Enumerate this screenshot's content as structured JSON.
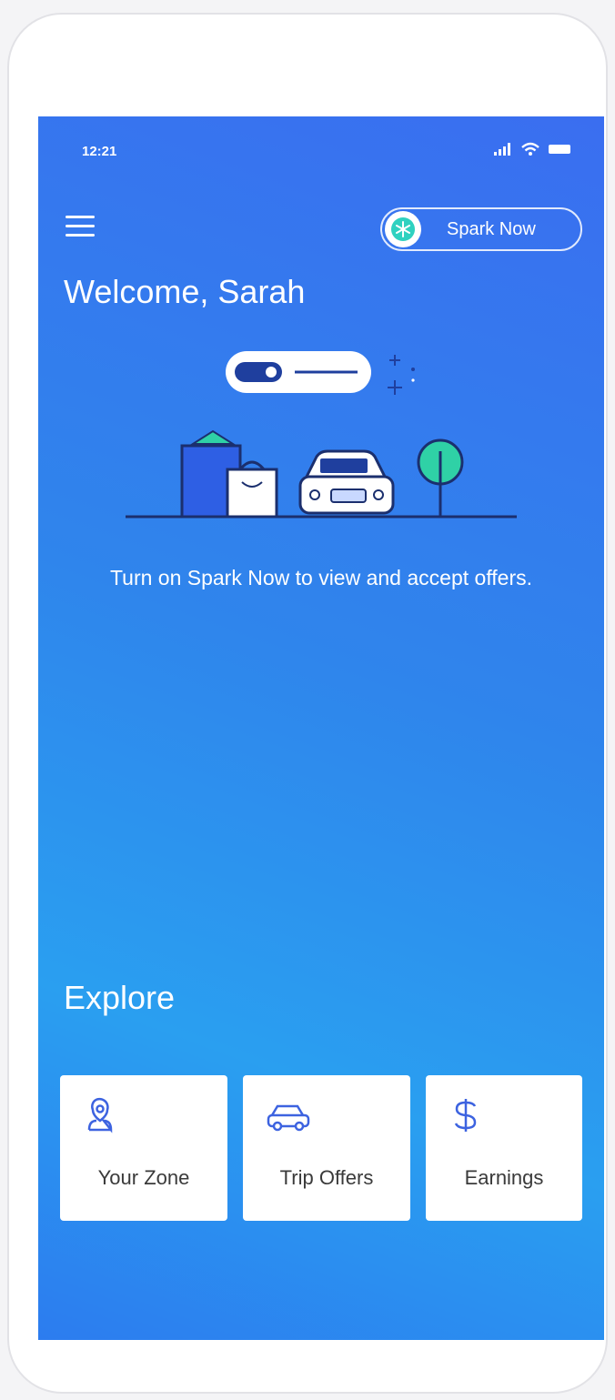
{
  "status": {
    "time": "12:21"
  },
  "header": {
    "spark_button_label": "Spark Now"
  },
  "welcome": {
    "title": "Welcome, Sarah"
  },
  "main": {
    "prompt": "Turn on Spark Now to view and accept offers."
  },
  "explore": {
    "title": "Explore",
    "cards": [
      {
        "label": "Your Zone",
        "icon": "location-user-icon"
      },
      {
        "label": "Trip Offers",
        "icon": "car-icon"
      },
      {
        "label": "Earnings",
        "icon": "dollar-icon"
      }
    ]
  },
  "colors": {
    "screen_gradient_start": "#3a6ef0",
    "screen_gradient_end": "#2a9ff0",
    "card_background": "#ffffff",
    "icon_blue": "#3d63e0",
    "tree_green": "#2fd1a6"
  }
}
